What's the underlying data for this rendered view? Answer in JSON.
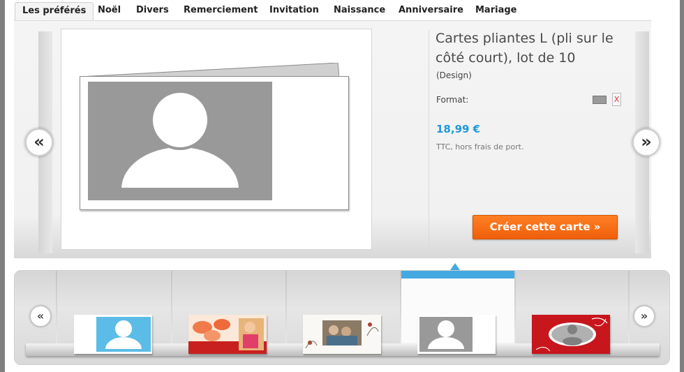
{
  "tabs": [
    {
      "label": "Les préférés",
      "active": true
    },
    {
      "label": "Noël"
    },
    {
      "label": "Divers"
    },
    {
      "label": "Remerciement"
    },
    {
      "label": "Invitation"
    },
    {
      "label": "Naissance"
    },
    {
      "label": "Anniversaire"
    },
    {
      "label": "Mariage"
    }
  ],
  "navigation": {
    "prev_glyph": "«",
    "next_glyph": "»"
  },
  "product": {
    "title": "Cartes pliantes L (pli sur le côté court), lot de 10",
    "subtitle": "(Design)",
    "format_label": "Format:",
    "format_option_x": "X",
    "price": "18,99 €",
    "price_note": "TTC, hors frais de port.",
    "create_button": "Créer cette carte »"
  },
  "colors": {
    "accent_blue": "#44a8e1",
    "price_blue": "#1e9ad8",
    "button_orange": "#f27020",
    "placeholder_gray": "#999999"
  },
  "thumbnails": [
    {
      "design": "blue-person-placeholder"
    },
    {
      "design": "orange-flowers-photo"
    },
    {
      "design": "vintage-floral-photo"
    },
    {
      "design": "gray-person-placeholder",
      "selected": true
    },
    {
      "design": "red-ornamental-photo"
    }
  ]
}
